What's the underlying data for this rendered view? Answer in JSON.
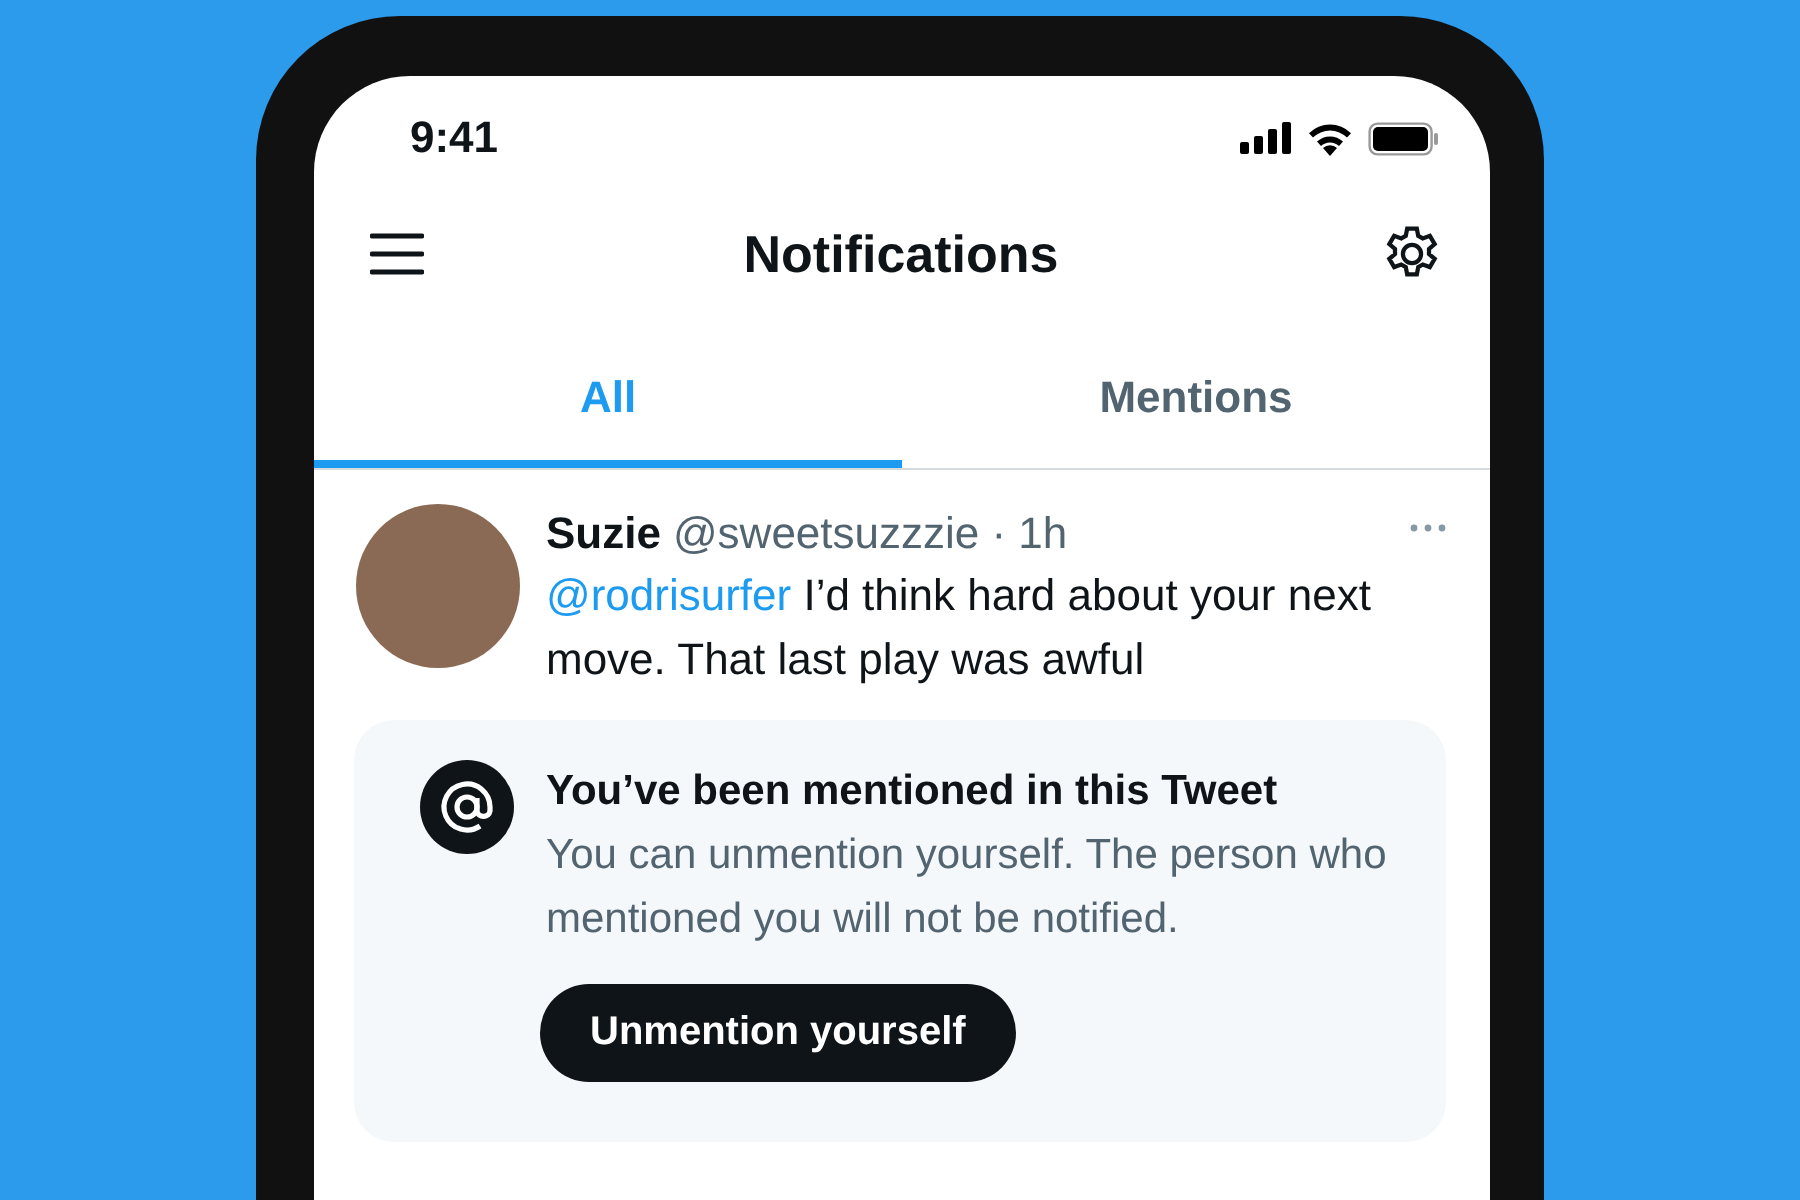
{
  "status_bar": {
    "time": "9:41"
  },
  "header": {
    "title": "Notifications"
  },
  "tabs": [
    {
      "label": "All",
      "selected": true
    },
    {
      "label": "Mentions",
      "selected": false
    }
  ],
  "tweet": {
    "name": "Suzie",
    "meta": "@sweetsuzzzie · 1h",
    "mention": "@rodrisurfer",
    "text": "I’d think hard about your next move. That last play was awful"
  },
  "notice": {
    "title": "You’ve been mentioned in this Tweet",
    "body": "You can unmention yourself. The person who mentioned you will not be notified.",
    "button": "Unmention yourself"
  }
}
